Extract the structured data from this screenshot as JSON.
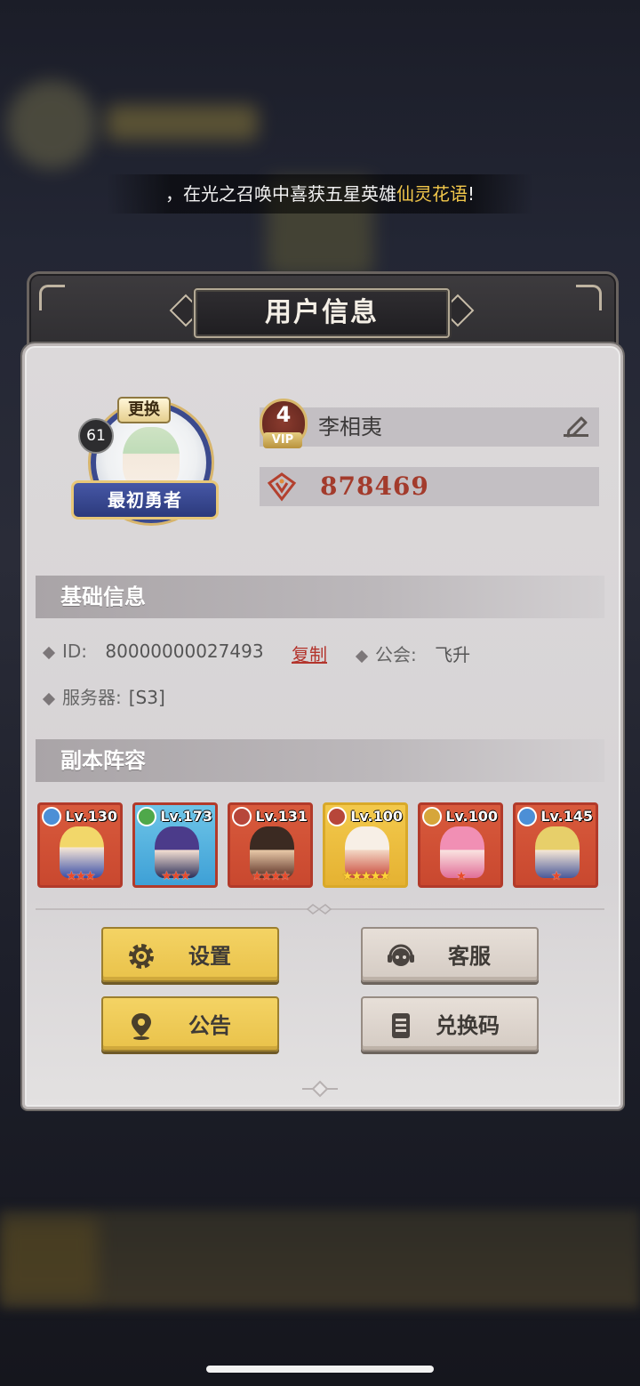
{
  "banner": {
    "prefix": "，在光之召唤中喜获五星英雄",
    "hero_name": "仙灵花语",
    "suffix": "!"
  },
  "panel": {
    "title": "用户信息"
  },
  "profile": {
    "avatar_level": "61",
    "change_label": "更换",
    "title_label": "最初勇者",
    "vip_level": "4",
    "vip_label": "VIP",
    "name": "李相夷",
    "currency_value": "878469"
  },
  "basic_info": {
    "header": "基础信息",
    "id_label": "ID:",
    "id_value": "80000000027493",
    "copy_label": "复制",
    "guild_label": "公会:",
    "guild_value": "飞升",
    "server_label": "服务器:",
    "server_value": "[S3]"
  },
  "lineup": {
    "header": "副本阵容",
    "heroes": [
      {
        "level": "Lv.130",
        "stars": "★★★",
        "element_color": "#4c8fd6"
      },
      {
        "level": "Lv.173",
        "stars": "★★★",
        "element_color": "#4fa84a"
      },
      {
        "level": "Lv.131",
        "stars": "★★★★",
        "element_color": "#b7463a"
      },
      {
        "level": "Lv.100",
        "stars": "★★★★★",
        "element_color": "#b7463a"
      },
      {
        "level": "Lv.100",
        "stars": "★",
        "element_color": "#d6a63a"
      },
      {
        "level": "Lv.145",
        "stars": "★",
        "element_color": "#4c8fd6"
      }
    ]
  },
  "buttons": {
    "settings": "设置",
    "support": "客服",
    "notice": "公告",
    "redeem": "兑换码"
  },
  "colors": {
    "accent_red": "#a33b2c",
    "button_yellow": "#f0cd5a",
    "button_grey": "#ddd5ce"
  }
}
